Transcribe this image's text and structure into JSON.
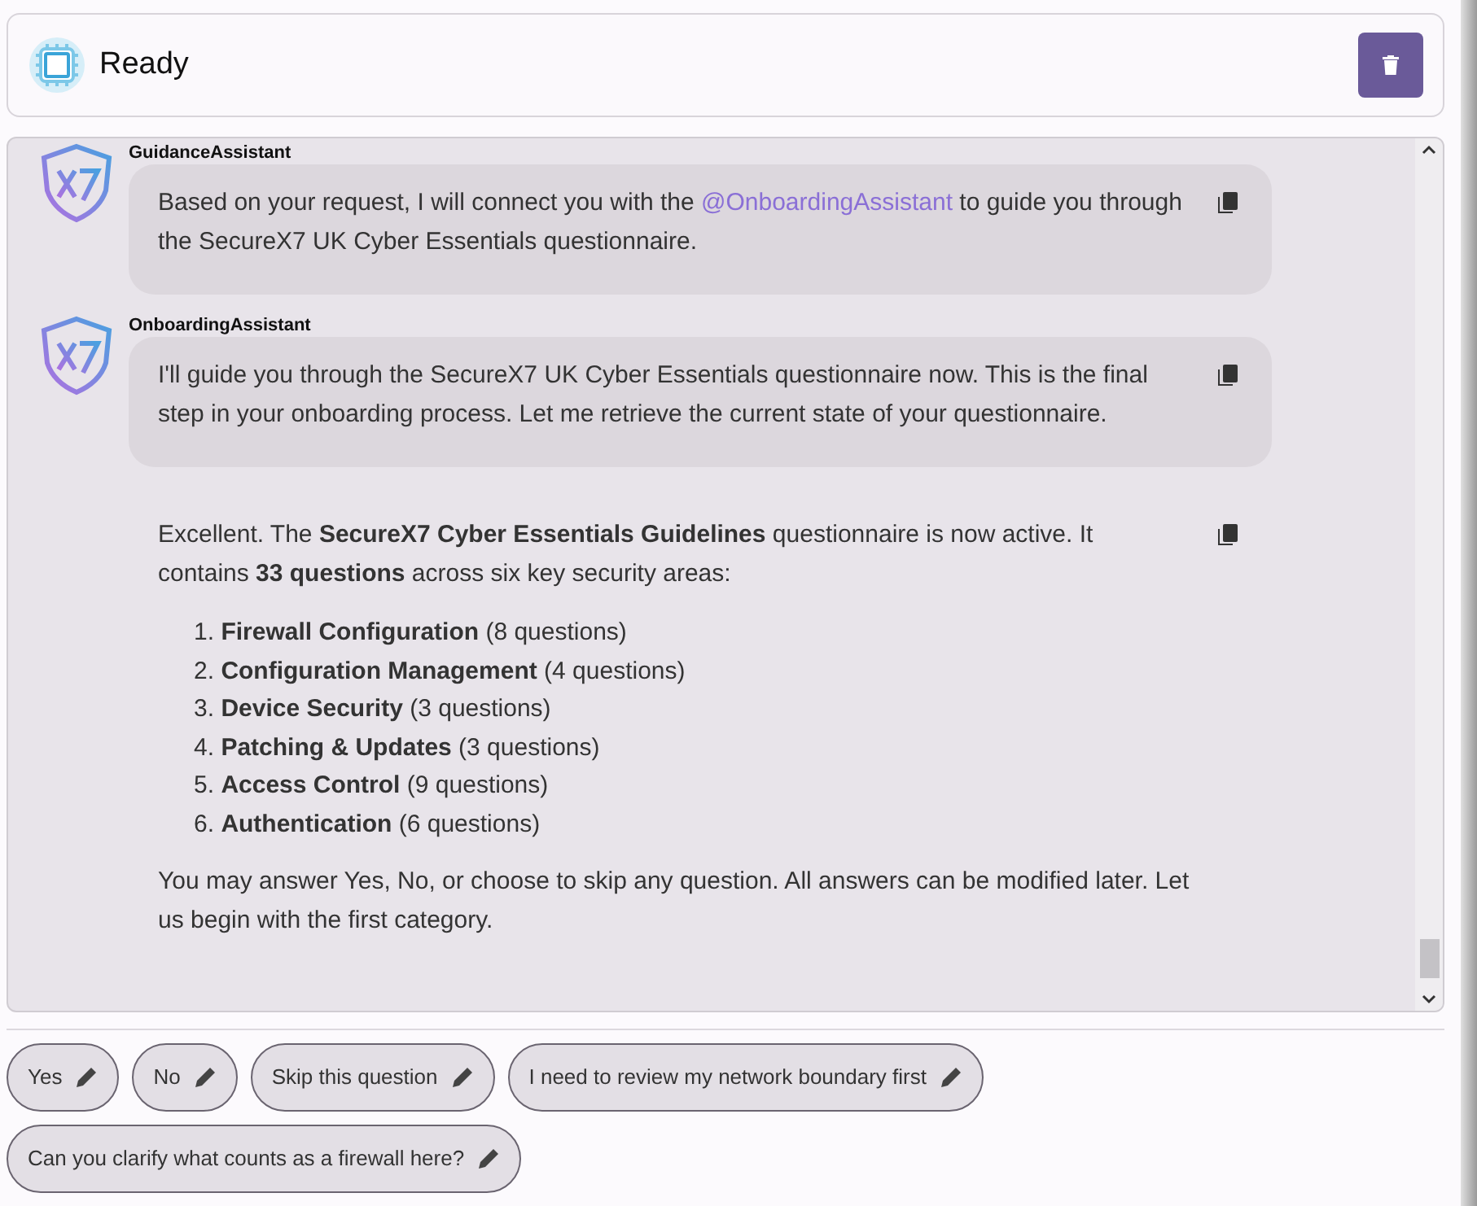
{
  "header": {
    "status": "Ready"
  },
  "messages": [
    {
      "sender": "GuidanceAssistant",
      "kind": "bubble",
      "parts": [
        {
          "kind": "text",
          "text": "Based on your request, I will connect you with the "
        },
        {
          "kind": "mention",
          "text": "@OnboardingAssistant"
        },
        {
          "kind": "text",
          "text": " to guide you through the SecureX7 UK Cyber Essentials questionnaire."
        }
      ]
    },
    {
      "sender": "OnboardingAssistant",
      "kind": "bubble",
      "parts": [
        {
          "kind": "text",
          "text": "I'll guide you through the SecureX7 UK Cyber Essentials questionnaire now. This is the final step in your onboarding process. Let me retrieve the current state of your questionnaire."
        }
      ]
    },
    {
      "kind": "plain",
      "intro": "Excellent. The **SecureX7 Cyber Essentials Guidelines** questionnaire is now active. It contains **33 questions** across six key security areas:",
      "list": [
        {
          "number": "1.",
          "label": "Firewall Configuration",
          "detail": "(8 questions)"
        },
        {
          "number": "2.",
          "label": "Configuration Management",
          "detail": "(4 questions)"
        },
        {
          "number": "3.",
          "label": "Device Security",
          "detail": "(3 questions)"
        },
        {
          "number": "4.",
          "label": "Patching & Updates",
          "detail": "(3 questions)"
        },
        {
          "number": "5.",
          "label": "Access Control",
          "detail": "(9 questions)"
        },
        {
          "number": "6.",
          "label": "Authentication",
          "detail": "(6 questions)"
        }
      ],
      "outro": "You may answer Yes, No, or choose to skip any question. All answers can be modified later. Let us begin with the first category."
    }
  ],
  "suggestions": [
    "Yes",
    "No",
    "Skip this question",
    "I need to review my network boundary first",
    "Can you clarify what counts as a firewall here?"
  ]
}
